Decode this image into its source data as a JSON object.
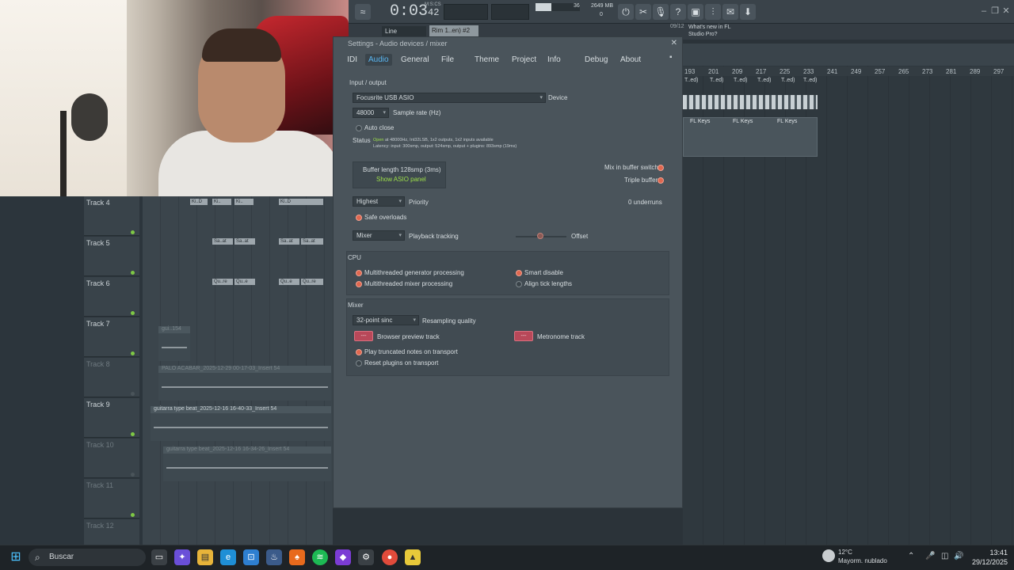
{
  "app": {
    "time": "0:03",
    "time_fraction": "42",
    "mcs": "M:S:CS",
    "cpu": "36",
    "memory": "2649 MB",
    "memory_sub": "0",
    "snap": "Line",
    "pattern": "Rim 1..en) #2",
    "news_date": "09/12",
    "news_text": "What's new in FL Studio Pro?"
  },
  "tracks": [
    {
      "name": "Track 4",
      "active": true
    },
    {
      "name": "Track 5",
      "active": true
    },
    {
      "name": "Track 6",
      "active": true
    },
    {
      "name": "Track 7",
      "active": true
    },
    {
      "name": "Track 8",
      "active": false
    },
    {
      "name": "Track 9",
      "active": true
    },
    {
      "name": "Track 10",
      "active": false
    },
    {
      "name": "Track 11",
      "active": false
    },
    {
      "name": "Track 12",
      "active": false
    }
  ],
  "clips": {
    "track4": [
      "Ki..D",
      "Ki..",
      "Ki..",
      "Ki..D"
    ],
    "track5": [
      "Sa..at",
      "Sa..at",
      "Sa..at",
      "Sa..at"
    ],
    "track6": [
      "Qu..re",
      "Qu..e",
      "Qu..e",
      "Qu..re"
    ],
    "track7": "gui..154",
    "track8": "PALO ACABAR_2025-12-29 00-17-03_Insert 54",
    "track9": "guitarra type beat_2025-12-16 16-40-33_Insert 54",
    "track10": "guitarra type beat_2025-12-16 16-34-26_Insert 54"
  },
  "playlist": {
    "ruler": [
      "193",
      "201",
      "209",
      "217",
      "225",
      "233",
      "241",
      "249",
      "257",
      "265",
      "273",
      "281",
      "289",
      "297"
    ],
    "pattern_label": "T..ed)",
    "keys_label": "FL Keys"
  },
  "dialog": {
    "title": "Settings - Audio devices / mixer",
    "tabs": [
      "MIDI",
      "Audio",
      "General",
      "File",
      "Theme",
      "Project",
      "Info",
      "Debug",
      "About"
    ],
    "io_header": "Input / output",
    "device": "Focusrite USB ASIO",
    "device_label": "Device",
    "sample_rate": "48000",
    "sample_rate_label": "Sample rate (Hz)",
    "auto_close": "Auto close",
    "status_label": "Status",
    "status_open": "Open",
    "status_text": "at 48000Hz, Int32LSB, 1x2 outputs, 1x2 inputs available",
    "latency_text": "Latency: input: 300smp, output: 524smp, output + plugins: 893smp (19ms)",
    "buffer_length": "Buffer length 128smp (3ms)",
    "show_asio": "Show ASIO panel",
    "mix_in_buffer": "Mix in buffer switch",
    "triple_buffer": "Triple buffer",
    "priority": "Highest",
    "priority_label": "Priority",
    "underruns": "0 underruns",
    "safe_overloads": "Safe overloads",
    "playback_tracking": "Mixer",
    "playback_tracking_label": "Playback tracking",
    "offset_label": "Offset",
    "cpu_header": "CPU",
    "multi_gen": "Multithreaded generator processing",
    "multi_mix": "Multithreaded mixer processing",
    "smart_disable": "Smart disable",
    "align_tick": "Align tick lengths",
    "mixer_header": "Mixer",
    "resampling": "32-point sinc",
    "resampling_label": "Resampling quality",
    "browser_preview": "Browser preview track",
    "metronome": "Metronome track",
    "track_btn": "---",
    "play_truncated": "Play truncated notes on transport",
    "reset_plugins": "Reset plugins on transport"
  },
  "taskbar": {
    "search": "Buscar",
    "temp": "12°C",
    "weather": "Mayorm. nublado",
    "time": "13:41",
    "date": "29/12/2025"
  }
}
